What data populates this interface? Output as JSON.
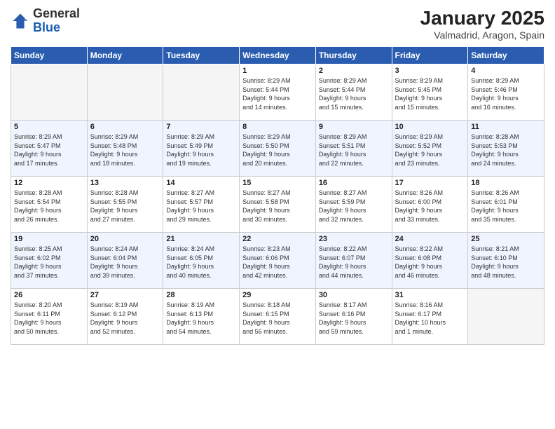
{
  "header": {
    "logo": {
      "general": "General",
      "blue": "Blue"
    },
    "title": "January 2025",
    "subtitle": "Valmadrid, Aragon, Spain"
  },
  "weekdays": [
    "Sunday",
    "Monday",
    "Tuesday",
    "Wednesday",
    "Thursday",
    "Friday",
    "Saturday"
  ],
  "weeks": [
    [
      {
        "day": "",
        "info": ""
      },
      {
        "day": "",
        "info": ""
      },
      {
        "day": "",
        "info": ""
      },
      {
        "day": "1",
        "info": "Sunrise: 8:29 AM\nSunset: 5:44 PM\nDaylight: 9 hours\nand 14 minutes."
      },
      {
        "day": "2",
        "info": "Sunrise: 8:29 AM\nSunset: 5:44 PM\nDaylight: 9 hours\nand 15 minutes."
      },
      {
        "day": "3",
        "info": "Sunrise: 8:29 AM\nSunset: 5:45 PM\nDaylight: 9 hours\nand 15 minutes."
      },
      {
        "day": "4",
        "info": "Sunrise: 8:29 AM\nSunset: 5:46 PM\nDaylight: 9 hours\nand 16 minutes."
      }
    ],
    [
      {
        "day": "5",
        "info": "Sunrise: 8:29 AM\nSunset: 5:47 PM\nDaylight: 9 hours\nand 17 minutes."
      },
      {
        "day": "6",
        "info": "Sunrise: 8:29 AM\nSunset: 5:48 PM\nDaylight: 9 hours\nand 18 minutes."
      },
      {
        "day": "7",
        "info": "Sunrise: 8:29 AM\nSunset: 5:49 PM\nDaylight: 9 hours\nand 19 minutes."
      },
      {
        "day": "8",
        "info": "Sunrise: 8:29 AM\nSunset: 5:50 PM\nDaylight: 9 hours\nand 20 minutes."
      },
      {
        "day": "9",
        "info": "Sunrise: 8:29 AM\nSunset: 5:51 PM\nDaylight: 9 hours\nand 22 minutes."
      },
      {
        "day": "10",
        "info": "Sunrise: 8:29 AM\nSunset: 5:52 PM\nDaylight: 9 hours\nand 23 minutes."
      },
      {
        "day": "11",
        "info": "Sunrise: 8:28 AM\nSunset: 5:53 PM\nDaylight: 9 hours\nand 24 minutes."
      }
    ],
    [
      {
        "day": "12",
        "info": "Sunrise: 8:28 AM\nSunset: 5:54 PM\nDaylight: 9 hours\nand 26 minutes."
      },
      {
        "day": "13",
        "info": "Sunrise: 8:28 AM\nSunset: 5:55 PM\nDaylight: 9 hours\nand 27 minutes."
      },
      {
        "day": "14",
        "info": "Sunrise: 8:27 AM\nSunset: 5:57 PM\nDaylight: 9 hours\nand 29 minutes."
      },
      {
        "day": "15",
        "info": "Sunrise: 8:27 AM\nSunset: 5:58 PM\nDaylight: 9 hours\nand 30 minutes."
      },
      {
        "day": "16",
        "info": "Sunrise: 8:27 AM\nSunset: 5:59 PM\nDaylight: 9 hours\nand 32 minutes."
      },
      {
        "day": "17",
        "info": "Sunrise: 8:26 AM\nSunset: 6:00 PM\nDaylight: 9 hours\nand 33 minutes."
      },
      {
        "day": "18",
        "info": "Sunrise: 8:26 AM\nSunset: 6:01 PM\nDaylight: 9 hours\nand 35 minutes."
      }
    ],
    [
      {
        "day": "19",
        "info": "Sunrise: 8:25 AM\nSunset: 6:02 PM\nDaylight: 9 hours\nand 37 minutes."
      },
      {
        "day": "20",
        "info": "Sunrise: 8:24 AM\nSunset: 6:04 PM\nDaylight: 9 hours\nand 39 minutes."
      },
      {
        "day": "21",
        "info": "Sunrise: 8:24 AM\nSunset: 6:05 PM\nDaylight: 9 hours\nand 40 minutes."
      },
      {
        "day": "22",
        "info": "Sunrise: 8:23 AM\nSunset: 6:06 PM\nDaylight: 9 hours\nand 42 minutes."
      },
      {
        "day": "23",
        "info": "Sunrise: 8:22 AM\nSunset: 6:07 PM\nDaylight: 9 hours\nand 44 minutes."
      },
      {
        "day": "24",
        "info": "Sunrise: 8:22 AM\nSunset: 6:08 PM\nDaylight: 9 hours\nand 46 minutes."
      },
      {
        "day": "25",
        "info": "Sunrise: 8:21 AM\nSunset: 6:10 PM\nDaylight: 9 hours\nand 48 minutes."
      }
    ],
    [
      {
        "day": "26",
        "info": "Sunrise: 8:20 AM\nSunset: 6:11 PM\nDaylight: 9 hours\nand 50 minutes."
      },
      {
        "day": "27",
        "info": "Sunrise: 8:19 AM\nSunset: 6:12 PM\nDaylight: 9 hours\nand 52 minutes."
      },
      {
        "day": "28",
        "info": "Sunrise: 8:19 AM\nSunset: 6:13 PM\nDaylight: 9 hours\nand 54 minutes."
      },
      {
        "day": "29",
        "info": "Sunrise: 8:18 AM\nSunset: 6:15 PM\nDaylight: 9 hours\nand 56 minutes."
      },
      {
        "day": "30",
        "info": "Sunrise: 8:17 AM\nSunset: 6:16 PM\nDaylight: 9 hours\nand 59 minutes."
      },
      {
        "day": "31",
        "info": "Sunrise: 8:16 AM\nSunset: 6:17 PM\nDaylight: 10 hours\nand 1 minute."
      },
      {
        "day": "",
        "info": ""
      }
    ]
  ]
}
